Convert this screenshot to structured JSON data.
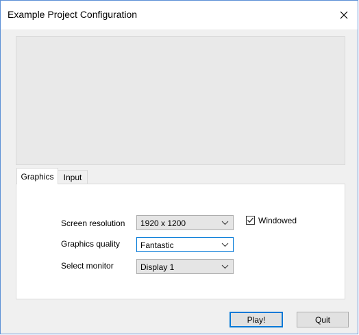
{
  "window": {
    "title": "Example Project Configuration"
  },
  "tabs": [
    {
      "label": "Graphics",
      "selected": true
    },
    {
      "label": "Input",
      "selected": false
    }
  ],
  "graphics": {
    "resolution": {
      "label": "Screen resolution",
      "value": "1920 x 1200"
    },
    "quality": {
      "label": "Graphics quality",
      "value": "Fantastic"
    },
    "monitor": {
      "label": "Select monitor",
      "value": "Display 1"
    },
    "windowed": {
      "label": "Windowed",
      "checked": true
    }
  },
  "buttons": {
    "play": "Play!",
    "quit": "Quit"
  },
  "icons": {
    "close": "close-icon",
    "dropdown": "chevron-down-icon",
    "check": "checkmark-icon"
  },
  "colors": {
    "accent": "#0078d7",
    "window_border": "#5b8fd6",
    "background": "#f0f0f0"
  }
}
